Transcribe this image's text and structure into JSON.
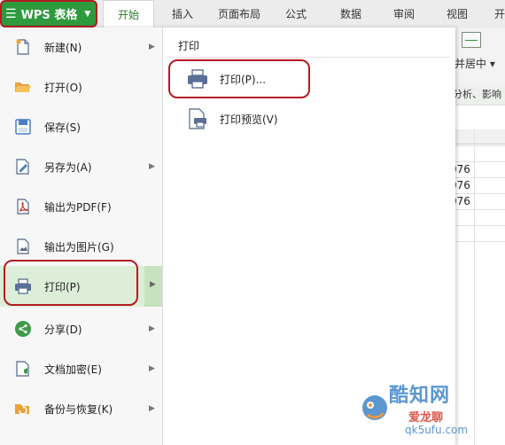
{
  "topbar": {
    "app_button_label": "WPS 表格",
    "tabs": [
      "开始",
      "插入",
      "页面布局",
      "公式",
      "数据",
      "审阅",
      "视图",
      "开"
    ]
  },
  "background": {
    "merge_label": "并居中 ▾",
    "analysis_text": "分析、影响",
    "cell_values": [
      "076",
      "076",
      "076"
    ]
  },
  "file_menu": {
    "items": [
      {
        "label": "新建(N)",
        "icon": "new-doc-icon",
        "has_submenu": true
      },
      {
        "label": "打开(O)",
        "icon": "open-folder-icon",
        "has_submenu": false
      },
      {
        "label": "保存(S)",
        "icon": "save-icon",
        "has_submenu": false
      },
      {
        "label": "另存为(A)",
        "icon": "save-as-icon",
        "has_submenu": true
      },
      {
        "label": "输出为PDF(F)",
        "icon": "pdf-icon",
        "has_submenu": false
      },
      {
        "label": "输出为图片(G)",
        "icon": "image-export-icon",
        "has_submenu": false
      },
      {
        "label": "打印(P)",
        "icon": "printer-icon",
        "has_submenu": true,
        "selected": true
      },
      {
        "label": "分享(D)",
        "icon": "share-icon",
        "has_submenu": true
      },
      {
        "label": "文档加密(E)",
        "icon": "encrypt-icon",
        "has_submenu": true
      },
      {
        "label": "备份与恢复(K)",
        "icon": "backup-icon",
        "has_submenu": true
      }
    ],
    "submenu": {
      "title": "打印",
      "items": [
        {
          "label": "打印(P)...",
          "icon": "printer-icon"
        },
        {
          "label": "打印预览(V)",
          "icon": "print-preview-icon"
        }
      ]
    }
  },
  "watermark": {
    "line1": "酷知网",
    "line2": "爱龙聊",
    "line3": "qk5ufu.com"
  },
  "colors": {
    "brand_green": "#2f9a3d",
    "highlight_ring": "#b41b22",
    "selected_bg": "#ddeed8"
  }
}
